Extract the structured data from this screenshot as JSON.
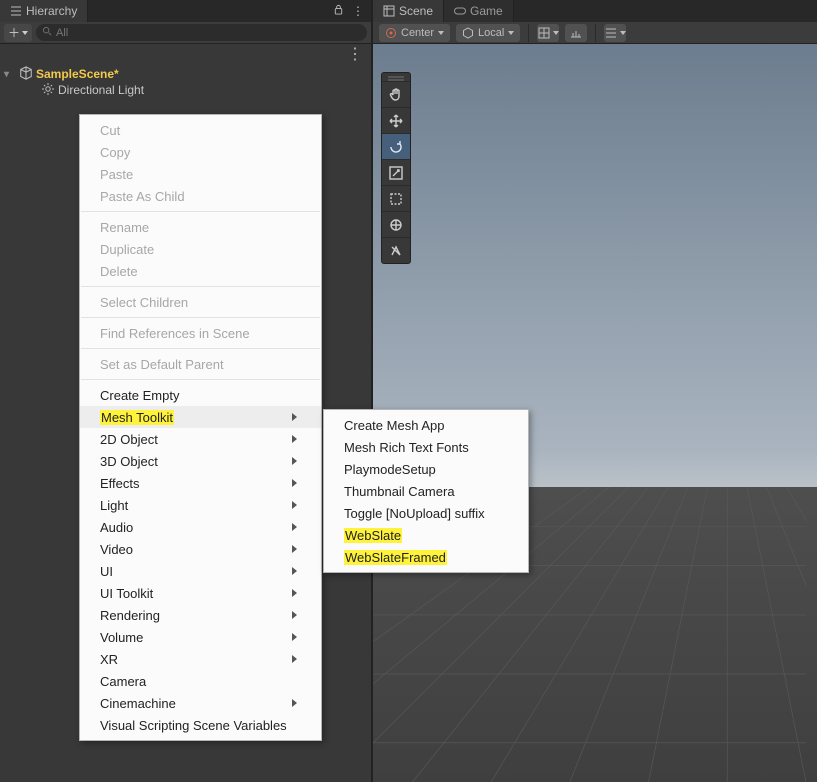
{
  "hierarchy": {
    "tab_label": "Hierarchy",
    "search_placeholder": "All",
    "scene_name": "SampleScene*",
    "child_name": "Directional Light"
  },
  "scene": {
    "tab_scene": "Scene",
    "tab_game": "Game",
    "pivot_label": "Center",
    "space_label": "Local"
  },
  "tools": [
    {
      "name": "hand",
      "active": false
    },
    {
      "name": "move",
      "active": false
    },
    {
      "name": "rotate",
      "active": true
    },
    {
      "name": "scale",
      "active": false
    },
    {
      "name": "rect",
      "active": false
    },
    {
      "name": "transform",
      "active": false
    },
    {
      "name": "custom",
      "active": false
    }
  ],
  "context_menu": {
    "groups": [
      [
        {
          "label": "Cut",
          "enabled": false
        },
        {
          "label": "Copy",
          "enabled": false
        },
        {
          "label": "Paste",
          "enabled": false
        },
        {
          "label": "Paste As Child",
          "enabled": false
        }
      ],
      [
        {
          "label": "Rename",
          "enabled": false
        },
        {
          "label": "Duplicate",
          "enabled": false
        },
        {
          "label": "Delete",
          "enabled": false
        }
      ],
      [
        {
          "label": "Select Children",
          "enabled": false
        }
      ],
      [
        {
          "label": "Find References in Scene",
          "enabled": false
        }
      ],
      [
        {
          "label": "Set as Default Parent",
          "enabled": false
        }
      ],
      [
        {
          "label": "Create Empty",
          "enabled": true
        },
        {
          "label": "Mesh Toolkit",
          "enabled": true,
          "submenu": true,
          "highlight": true,
          "hover": true
        },
        {
          "label": "2D Object",
          "enabled": true,
          "submenu": true
        },
        {
          "label": "3D Object",
          "enabled": true,
          "submenu": true
        },
        {
          "label": "Effects",
          "enabled": true,
          "submenu": true
        },
        {
          "label": "Light",
          "enabled": true,
          "submenu": true
        },
        {
          "label": "Audio",
          "enabled": true,
          "submenu": true
        },
        {
          "label": "Video",
          "enabled": true,
          "submenu": true
        },
        {
          "label": "UI",
          "enabled": true,
          "submenu": true
        },
        {
          "label": "UI Toolkit",
          "enabled": true,
          "submenu": true
        },
        {
          "label": "Rendering",
          "enabled": true,
          "submenu": true
        },
        {
          "label": "Volume",
          "enabled": true,
          "submenu": true
        },
        {
          "label": "XR",
          "enabled": true,
          "submenu": true
        },
        {
          "label": "Camera",
          "enabled": true
        },
        {
          "label": "Cinemachine",
          "enabled": true,
          "submenu": true
        },
        {
          "label": "Visual Scripting Scene Variables",
          "enabled": true
        }
      ]
    ]
  },
  "submenu": [
    {
      "label": "Create Mesh App"
    },
    {
      "label": "Mesh Rich Text Fonts"
    },
    {
      "label": "PlaymodeSetup"
    },
    {
      "label": "Thumbnail Camera"
    },
    {
      "label": "Toggle [NoUpload] suffix"
    },
    {
      "label": "WebSlate",
      "highlight": true
    },
    {
      "label": "WebSlateFramed",
      "highlight": true
    }
  ]
}
